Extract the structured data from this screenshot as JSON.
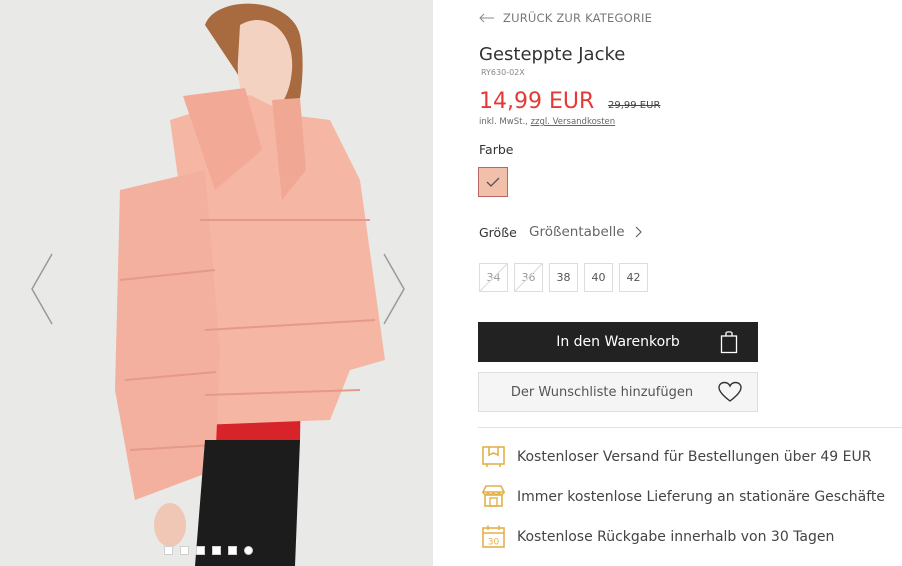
{
  "gallery": {
    "prev_icon": "chevron-left-icon",
    "next_icon": "chevron-right-icon",
    "dots": 6,
    "active_dot": 6
  },
  "nav": {
    "back_label": "ZURÜCK ZUR KATEGORIE"
  },
  "product": {
    "title": "Gesteppte Jacke",
    "sku": "RY630-02X",
    "price": "14,99 EUR",
    "old_price": "29,99 EUR",
    "tax_prefix": "inkl. MwSt.,",
    "shipping_link": "zzgl. Versandkosten",
    "color_label": "Farbe",
    "swatch_color": "#f2bfaa",
    "size_label": "Größe",
    "size_table_label": "Größentabelle",
    "sizes": [
      {
        "label": "34",
        "available": false
      },
      {
        "label": "36",
        "available": false
      },
      {
        "label": "38",
        "available": true
      },
      {
        "label": "40",
        "available": true
      },
      {
        "label": "42",
        "available": true
      }
    ]
  },
  "actions": {
    "cart_label": "In den Warenkorb",
    "wishlist_label": "Der Wunschliste hinzufügen"
  },
  "benefits": [
    {
      "icon": "delivery-box-icon",
      "text": "Kostenloser Versand für Bestellungen über 49 EUR"
    },
    {
      "icon": "store-icon",
      "text": "Immer kostenlose Lieferung an stationäre Geschäfte"
    },
    {
      "icon": "calendar-30-icon",
      "text": "Kostenlose Rückgabe innerhalb von 30 Tagen"
    }
  ],
  "colors": {
    "accent": "#e53935",
    "icon_gold": "#e3b04b",
    "button_dark": "#222222"
  }
}
